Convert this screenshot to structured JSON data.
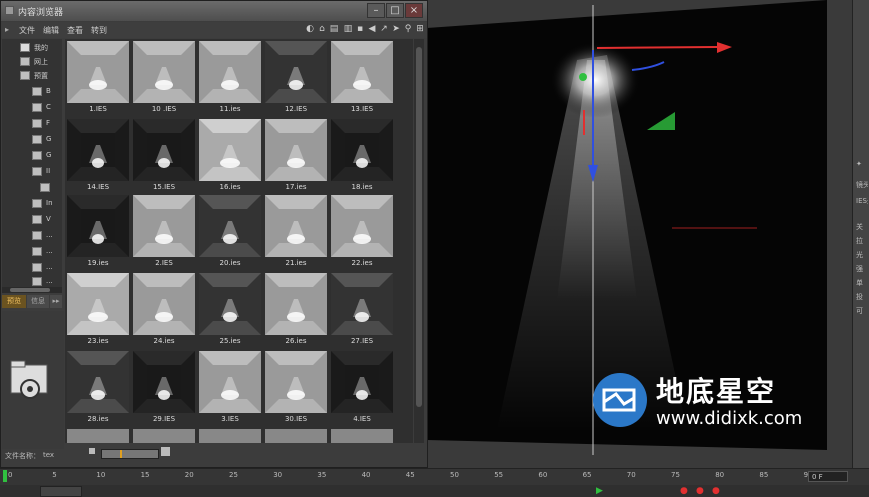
{
  "window": {
    "title": "内容浏览器"
  },
  "menu": [
    "文件",
    "编辑",
    "查看",
    "转到"
  ],
  "tree": [
    {
      "label": "我的"
    },
    {
      "label": "网上"
    },
    {
      "label": "预置"
    },
    {
      "label": "B"
    },
    {
      "label": "C"
    },
    {
      "label": "F"
    },
    {
      "label": "G"
    },
    {
      "label": "G"
    },
    {
      "label": "II"
    },
    {
      "label": ""
    },
    {
      "label": "In"
    },
    {
      "label": "V"
    },
    {
      "label": "..."
    },
    {
      "label": "..."
    },
    {
      "label": "..."
    },
    {
      "label": "..."
    }
  ],
  "tabs": {
    "preview": "预览",
    "info": "信息"
  },
  "status": {
    "filename_label": "文件名称：",
    "filename_value": "tex"
  },
  "thumbnails": [
    {
      "label": "1.IES"
    },
    {
      "label": "10 .IES"
    },
    {
      "label": "11.ies"
    },
    {
      "label": "12.IES"
    },
    {
      "label": "13.IES"
    },
    {
      "label": "14.IES"
    },
    {
      "label": "15.IES"
    },
    {
      "label": "16.ies"
    },
    {
      "label": "17.ies"
    },
    {
      "label": "18.ies"
    },
    {
      "label": "19.ies"
    },
    {
      "label": "2.IES"
    },
    {
      "label": "20.ies"
    },
    {
      "label": "21.ies"
    },
    {
      "label": "22.ies"
    },
    {
      "label": "23.ies"
    },
    {
      "label": "24.ies"
    },
    {
      "label": "25.ies"
    },
    {
      "label": "26.ies"
    },
    {
      "label": "27.IES"
    },
    {
      "label": "28.ies"
    },
    {
      "label": "29.IES"
    },
    {
      "label": "3.IES"
    },
    {
      "label": "30.IES"
    },
    {
      "label": "4.IES"
    }
  ],
  "timeline": {
    "ticks": [
      "0",
      "5",
      "10",
      "15",
      "20",
      "25",
      "30",
      "35",
      "40",
      "45",
      "50",
      "55",
      "60",
      "65",
      "70",
      "75",
      "80",
      "85",
      "90"
    ],
    "frame": "0 F"
  },
  "right_panel": [
    "镜头",
    "IES光",
    "关",
    "拉",
    "光",
    "强",
    "单",
    "投",
    "可"
  ],
  "watermark": {
    "title": "地底星空",
    "url": "www.didixk.com"
  },
  "colors": {
    "x_axis": "#e23030",
    "y_axis": "#30c040",
    "z_axis": "#3050e0",
    "watermark_blue": "#2b78c8"
  }
}
